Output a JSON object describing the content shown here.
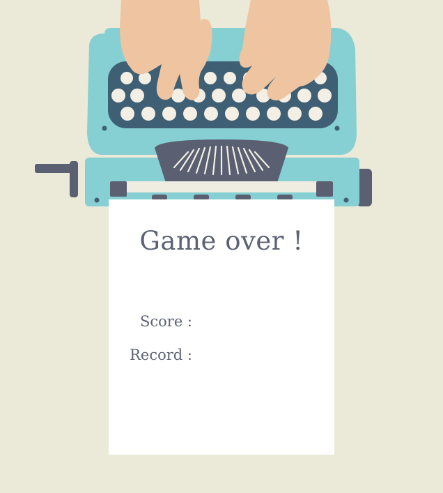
{
  "game_over": {
    "title": "Game over !",
    "score_label": "Score :",
    "score_value": "",
    "record_label": "Record :",
    "record_value": ""
  },
  "illustration": {
    "subject": "typewriter-with-typing-hands",
    "colors": {
      "background": "#ebe9d8",
      "typewriter_body": "#86cfd2",
      "keyboard_panel": "#3f5f74",
      "keys": "#f3efe4",
      "hands": "#efc5a1",
      "dark_parts": "#5a5f72",
      "paper": "#ffffff",
      "text": "#5c6272"
    }
  }
}
